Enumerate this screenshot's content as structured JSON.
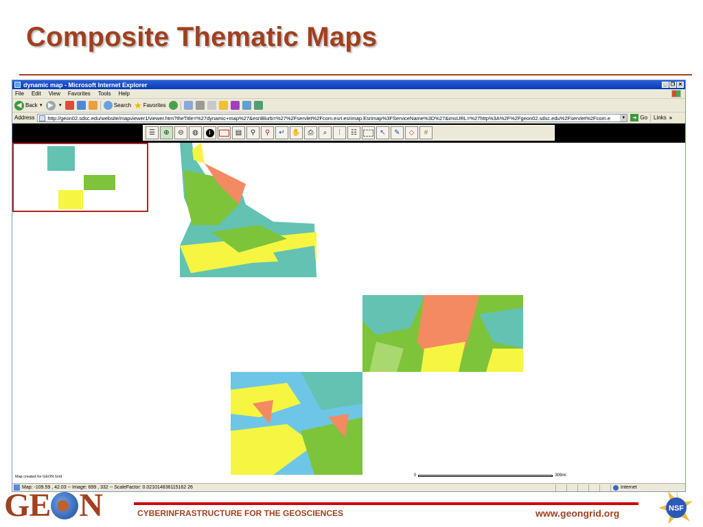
{
  "slide": {
    "title": "Composite Thematic Maps"
  },
  "browser": {
    "window_title": "dynamic map - Microsoft Internet Explorer",
    "window_buttons": [
      "_",
      "❐",
      "✕"
    ],
    "menu": [
      "File",
      "Edit",
      "View",
      "Favorites",
      "Tools",
      "Help"
    ],
    "toolbar": {
      "back": "Back",
      "search": "Search",
      "favorites": "Favorites"
    },
    "address": {
      "label": "Address",
      "url": "http://geon02.sdsc.edu/website/mapviewer1/viewer.htm?theTitle=%27dynamic+map%27&esriBlurb=%27%2Fservlet%2Fcom.esri.esrimap.Esrimap%3FServiceName%3D%27&imsURL=%27http%3A%2F%2Fgeon02.sdsc.edu%2Fservlet%2Fcom.e",
      "go": "Go",
      "links": "Links",
      "links_chevron": "»"
    },
    "status": {
      "text": "Map: -109.59 , 42.03 -- Image: 699 , 332 -- ScaleFactor: 0.021014836115162 26",
      "zone": "Internet"
    }
  },
  "map": {
    "caption": "Map created for GEON Grid",
    "scale_start": "0",
    "scale_end": "309mi",
    "tools": [
      {
        "name": "toggle-legend-tool",
        "icon": "legend-icon"
      },
      {
        "name": "zoom-in-tool",
        "icon": "zoom-in-icon"
      },
      {
        "name": "zoom-out-tool",
        "icon": "zoom-out-icon"
      },
      {
        "name": "full-extent-tool",
        "icon": "globe-extent-icon"
      },
      {
        "name": "identify-tool",
        "icon": "info-icon"
      },
      {
        "name": "select-rectangle-tool",
        "icon": "rectangle-icon"
      },
      {
        "name": "list-tool",
        "icon": "list-icon"
      },
      {
        "name": "zoom-active-layer-tool",
        "icon": "layer-zoom-icon"
      },
      {
        "name": "zoom-last-tool",
        "icon": "layer-zoom-2-icon"
      },
      {
        "name": "back-tool",
        "icon": "back-arrow-icon"
      },
      {
        "name": "pan-tool",
        "icon": "hand-icon"
      },
      {
        "name": "print-tool",
        "icon": "print-icon"
      },
      {
        "name": "find-tool",
        "icon": "find-icon"
      },
      {
        "name": "query-tool",
        "icon": "query-icon"
      },
      {
        "name": "buffer-tool",
        "icon": "buffer-icon"
      },
      {
        "name": "select-tool",
        "icon": "select-icon"
      },
      {
        "name": "measure-tool",
        "icon": "measure-icon"
      },
      {
        "name": "pin-tool",
        "icon": "pin-icon"
      },
      {
        "name": "eraser-tool",
        "icon": "eraser-icon"
      },
      {
        "name": "graticule-tool",
        "icon": "graticule-icon"
      }
    ],
    "colors": {
      "green": "#7dc43a",
      "teal": "#63c2b2",
      "salmon": "#f48a62",
      "yellow": "#f5f542",
      "lightblue": "#6ec6e6",
      "lightgreen": "#a8d86e"
    }
  },
  "footer": {
    "logo_text_left": "GE",
    "logo_text_right": "N",
    "tagline": "CYBERINFRASTRUCTURE FOR THE GEOSCIENCES",
    "url": "www.geongrid.org",
    "nsf": "NSF"
  }
}
